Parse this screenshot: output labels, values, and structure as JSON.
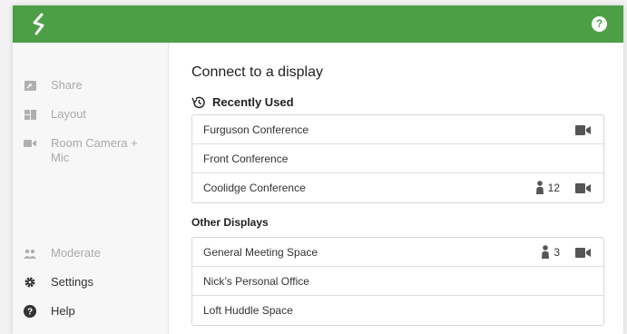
{
  "header": {
    "logo": "S",
    "help_icon": "help-icon"
  },
  "sidebar": {
    "items": [
      {
        "label": "Share",
        "icon": "share-icon",
        "active": false
      },
      {
        "label": "Layout",
        "icon": "layout-icon",
        "active": false
      },
      {
        "label": "Room Camera + Mic",
        "icon": "camera-icon",
        "active": false
      }
    ],
    "bottom_items": [
      {
        "label": "Moderate",
        "icon": "users-icon",
        "active": false
      },
      {
        "label": "Settings",
        "icon": "gear-icon",
        "active": true
      },
      {
        "label": "Help",
        "icon": "help-icon",
        "active": true
      }
    ]
  },
  "main": {
    "title": "Connect to a display",
    "recently_used_label": "Recently Used",
    "recently_used": [
      {
        "name": "Furguson Conference",
        "people": "",
        "camera": true
      },
      {
        "name": "Front Conference",
        "people": "",
        "camera": false
      },
      {
        "name": "Coolidge Conference",
        "people": "12",
        "camera": true
      }
    ],
    "other_label": "Other Displays",
    "other_displays": [
      {
        "name": "General Meeting Space",
        "people": "3",
        "camera": true
      },
      {
        "name": "Nick’s Personal Office",
        "people": "",
        "camera": false
      },
      {
        "name": "Loft Huddle Space",
        "people": "",
        "camera": false
      }
    ]
  },
  "colors": {
    "brand": "#4c9f45",
    "muted": "#a9a9a9",
    "text": "#333333"
  }
}
